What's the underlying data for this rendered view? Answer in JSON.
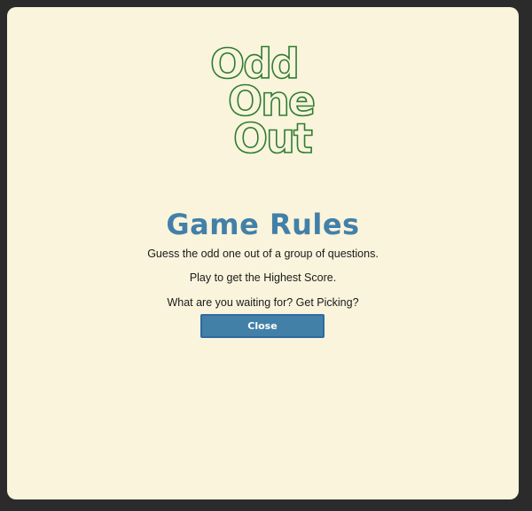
{
  "logo": {
    "line1": "Odd",
    "line2": "One",
    "line3": "Out",
    "stroke_color": "#2e7d32"
  },
  "rules": {
    "title": "Game Rules",
    "lines": [
      "Guess the odd one out of a group of questions.",
      "Play to get the Highest Score.",
      "What are you waiting for? Get Picking?"
    ],
    "close_label": "Close"
  },
  "colors": {
    "background": "#2b2b2b",
    "card": "#faf4dc",
    "accent": "#4280a8"
  }
}
